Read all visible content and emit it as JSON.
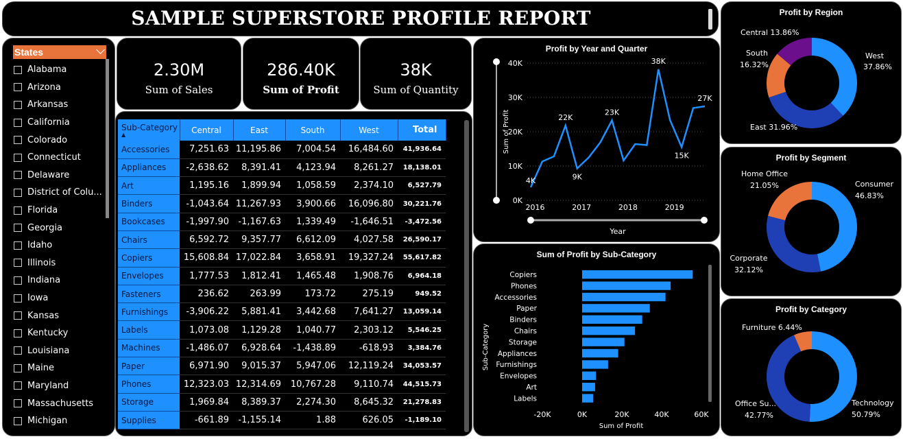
{
  "title": "SAMPLE SUPERSTORE PROFILE REPORT",
  "slicer": {
    "header": "States",
    "items": [
      "Alabama",
      "Arizona",
      "Arkansas",
      "California",
      "Colorado",
      "Connecticut",
      "Delaware",
      "District of Colu...",
      "Florida",
      "Georgia",
      "Idaho",
      "Illinois",
      "Indiana",
      "Iowa",
      "Kansas",
      "Kentucky",
      "Louisiana",
      "Maine",
      "Maryland",
      "Massachusetts",
      "Michigan"
    ]
  },
  "kpis": [
    {
      "value": "2.30M",
      "label": "Sum of Sales"
    },
    {
      "value": "286.40K",
      "label": "Sum of Profit"
    },
    {
      "value": "38K",
      "label": "Sum of Quantity"
    }
  ],
  "matrix": {
    "headers": [
      "Sub-Category",
      "Central",
      "East",
      "South",
      "West",
      "Total"
    ],
    "rows": [
      [
        "Accessories",
        "7,251.63",
        "11,195.86",
        "7,004.54",
        "16,484.60",
        "41,936.64"
      ],
      [
        "Appliances",
        "-2,638.62",
        "8,391.41",
        "4,123.94",
        "8,261.27",
        "18,138.01"
      ],
      [
        "Art",
        "1,195.16",
        "1,899.94",
        "1,058.59",
        "2,374.10",
        "6,527.79"
      ],
      [
        "Binders",
        "-1,043.64",
        "11,267.93",
        "3,900.66",
        "16,096.80",
        "30,221.76"
      ],
      [
        "Bookcases",
        "-1,997.90",
        "-1,167.63",
        "1,339.49",
        "-1,646.51",
        "-3,472.56"
      ],
      [
        "Chairs",
        "6,592.72",
        "9,357.77",
        "6,612.09",
        "4,027.58",
        "26,590.17"
      ],
      [
        "Copiers",
        "15,608.84",
        "17,022.84",
        "3,658.91",
        "19,327.24",
        "55,617.82"
      ],
      [
        "Envelopes",
        "1,777.53",
        "1,812.41",
        "1,465.48",
        "1,908.76",
        "6,964.18"
      ],
      [
        "Fasteners",
        "236.62",
        "263.99",
        "173.72",
        "275.19",
        "949.52"
      ],
      [
        "Furnishings",
        "-3,906.22",
        "5,881.41",
        "3,442.68",
        "7,641.27",
        "13,059.14"
      ],
      [
        "Labels",
        "1,073.08",
        "1,129.28",
        "1,040.77",
        "2,303.12",
        "5,546.25"
      ],
      [
        "Machines",
        "-1,486.07",
        "6,928.64",
        "-1,438.89",
        "-618.93",
        "3,384.76"
      ],
      [
        "Paper",
        "6,971.90",
        "9,015.37",
        "5,947.06",
        "12,119.24",
        "34,053.57"
      ],
      [
        "Phones",
        "12,323.03",
        "12,314.69",
        "10,767.28",
        "9,110.74",
        "44,515.73"
      ],
      [
        "Storage",
        "1,969.84",
        "8,389.37",
        "2,274.30",
        "8,645.32",
        "21,278.83"
      ],
      [
        "Supplies",
        "-661.89",
        "-1,155.14",
        "1.88",
        "626.05",
        "-1,189.10"
      ]
    ]
  },
  "chart_data": [
    {
      "type": "line",
      "title": "Profit by Year and Quarter",
      "xlabel": "Year",
      "ylabel": "Sum of Profit",
      "x_ticks": [
        "2016",
        "2017",
        "2018",
        "2019"
      ],
      "y_ticks": [
        "0K",
        "10K",
        "20K",
        "30K",
        "40K"
      ],
      "ylim": [
        0,
        40000
      ],
      "values": [
        3800,
        11300,
        12800,
        21800,
        9300,
        12500,
        16900,
        23300,
        11600,
        16400,
        16100,
        38200,
        23400,
        15500,
        26900,
        27400
      ],
      "data_labels": [
        {
          "index": 0,
          "text": "4K"
        },
        {
          "index": 3,
          "text": "22K"
        },
        {
          "index": 4,
          "text": "9K"
        },
        {
          "index": 7,
          "text": "23K"
        },
        {
          "index": 11,
          "text": "38K"
        },
        {
          "index": 13,
          "text": "15K"
        },
        {
          "index": 15,
          "text": "27K"
        }
      ]
    },
    {
      "type": "bar",
      "title": "Sum of Profit by Sub-Category",
      "xlabel": "Sum of Profit",
      "ylabel": "Sub-Category",
      "x_ticks": [
        "-20K",
        "0K",
        "20K",
        "40K",
        "60K"
      ],
      "xlim": [
        -20000,
        60000
      ],
      "categories": [
        "Copiers",
        "Phones",
        "Accessories",
        "Paper",
        "Binders",
        "Chairs",
        "Storage",
        "Appliances",
        "Furnishings",
        "Envelopes",
        "Art",
        "Labels"
      ],
      "values": [
        55617.82,
        44515.73,
        41936.64,
        34053.57,
        30221.76,
        26590.17,
        21278.83,
        18138.01,
        13059.14,
        6964.18,
        6527.79,
        5546.25
      ]
    },
    {
      "type": "pie",
      "title": "Profit by Region",
      "categories": [
        "West",
        "East",
        "South",
        "Central"
      ],
      "values": [
        37.86,
        31.96,
        16.32,
        13.86
      ],
      "colors": [
        "#1e90ff",
        "#1f3fb5",
        "#e8743b",
        "#6b0f8c"
      ]
    },
    {
      "type": "pie",
      "title": "Profit by Segment",
      "categories": [
        "Consumer",
        "Corporate",
        "Home Office"
      ],
      "values": [
        46.83,
        32.12,
        21.05
      ],
      "colors": [
        "#1e90ff",
        "#1f3fb5",
        "#e8743b"
      ]
    },
    {
      "type": "pie",
      "title": "Profit by Category",
      "categories": [
        "Technology",
        "Office Su...",
        "Furniture"
      ],
      "values": [
        50.79,
        42.77,
        6.44
      ],
      "colors": [
        "#1e90ff",
        "#1f3fb5",
        "#e8743b"
      ]
    }
  ],
  "donut_labels": {
    "region": [
      "West",
      "37.86%",
      "East 31.96%",
      "South",
      "16.32%",
      "Central 13.86%"
    ],
    "segment": [
      "Consumer",
      "46.83%",
      "Corporate",
      "32.12%",
      "Home Office",
      "21.05%"
    ],
    "category": [
      "Technology",
      "50.79%",
      "Office Su...",
      "42.77%",
      "Furniture 6.44%"
    ]
  }
}
